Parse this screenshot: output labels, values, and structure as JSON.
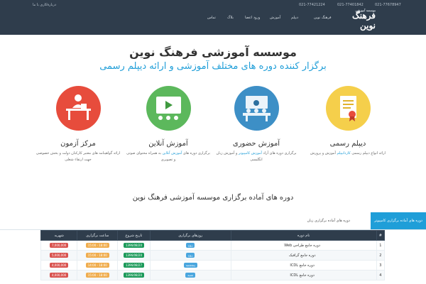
{
  "topbar": {
    "phones": [
      "021-77678947",
      "021-77401842",
      "021-77421224"
    ],
    "about": "دربارهٔ‌‌کاری با ما"
  },
  "logo": {
    "main": "فرهنگ نوین",
    "small": "موسسه آموزشی"
  },
  "menu": {
    "items": [
      {
        "label": "فرهنگ نوین"
      },
      {
        "label": "دیپلم"
      },
      {
        "label": "آموزش"
      },
      {
        "label": "ورود اعضا"
      },
      {
        "label": "بلاگ"
      },
      {
        "label": "تماس"
      }
    ]
  },
  "hero": {
    "title": "موسسه آموزشی فرهنگ نوین",
    "subtitle": "برگزار کننده دوره های مختلف آموزشی و ارائه دیپلم رسمی"
  },
  "features": [
    {
      "title": "دیپلم رسمی",
      "icon": "certificate-icon",
      "color": "#f5cf4b",
      "text": "ارائه انواع دیپلم رسمی",
      "accent": "کاردانیپلم",
      "text2": "آموزش و پرورش"
    },
    {
      "title": "آموزش حضوری",
      "icon": "classroom-icon",
      "color": "#3d8fc6",
      "text": "برگزاری دوره های آزاد",
      "accent": "آموزش کامپیوتر",
      "text2": "و آموزش زبان انگلیسی"
    },
    {
      "title": "آموزش آنلاین",
      "icon": "video-lesson-icon",
      "color": "#5cb85c",
      "text": "برگزاری دوره های",
      "accent": "آموزش آنلاین",
      "text2": "به همراه محتوای صوتی و تصویری"
    },
    {
      "title": "مرکز آزمون",
      "icon": "exam-desk-icon",
      "color": "#e74c3c",
      "text": "ارائه گواهینامه های معتبر",
      "accent": "",
      "text2": "کارکنان دولت و بخش خصوصی جهت ارتقاء شغلی"
    }
  ],
  "section": {
    "title": "دوره های آماده برگزاری موسسه آموزشی فرهنگ نوین"
  },
  "tabs": [
    {
      "label": "دوره های آماده برگزاری کامپیوتر",
      "active": true
    },
    {
      "label": "دوره های آماده برگزاری زبان",
      "active": false
    }
  ],
  "table": {
    "headers": [
      "#",
      "نام دوره",
      "روزهای برگزاری",
      "تاریخ شروع",
      "ساعت برگزاری",
      "شهریه"
    ],
    "rows": [
      {
        "num": "1",
        "name": "دوره جامع طراحی Web",
        "days": "زوج",
        "date": "1396/08/20",
        "time": "18:00 - 15:00",
        "price": "7,000,000"
      },
      {
        "num": "2",
        "name": "دوره جامع گرافیک",
        "days": "زوج",
        "date": "1396/08/20",
        "time": "18:00 - 15:00",
        "price": "5,000,000"
      },
      {
        "num": "3",
        "name": "دوره جامع ICDL",
        "days": "پنجشنبه",
        "date": "1396/08/27",
        "time": "18:00 - 14:00",
        "price": "4,000,000"
      },
      {
        "num": "4",
        "name": "دوره جامع ICDL",
        "days": "شنبه",
        "date": "1396/08/20",
        "time": "18:00 - 15:00",
        "price": "4,000,000"
      }
    ]
  }
}
